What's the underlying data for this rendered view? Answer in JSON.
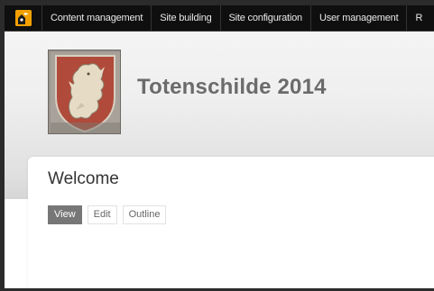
{
  "toolbar": {
    "items": [
      {
        "label": "Content management"
      },
      {
        "label": "Site building"
      },
      {
        "label": "Site configuration"
      },
      {
        "label": "User management"
      },
      {
        "label": "R"
      }
    ]
  },
  "header": {
    "site_name": "Totenschilde 2014"
  },
  "main": {
    "title": "Welcome",
    "tabs": [
      {
        "label": "View",
        "active": true
      },
      {
        "label": "Edit",
        "active": false
      },
      {
        "label": "Outline",
        "active": false
      }
    ]
  },
  "colors": {
    "toolbar_bg": "#0f0f0f",
    "accent_orange": "#f2a000",
    "active_tab": "#777777"
  },
  "icons": {
    "home": "drupal-home-icon",
    "logo": "coat-of-arms-shield"
  }
}
